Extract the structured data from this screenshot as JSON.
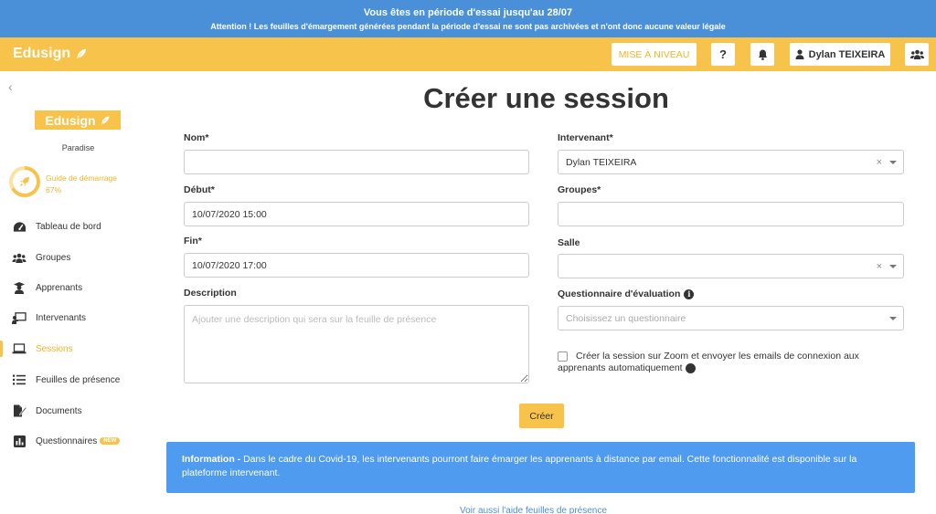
{
  "trial": {
    "line1": "Vous êtes en période d'essai jusqu'au 28/07",
    "line2": "Attention ! Les feuilles d'émargement générées pendant la période d'essai ne sont pas archivées et n'ont donc aucune valeur légale"
  },
  "navbar": {
    "brand": "Edusign",
    "upgrade_label": "MISE À NIVEAU",
    "help_label": "?",
    "user_name": "Dylan TEIXEIRA"
  },
  "sidebar": {
    "logo": "Edusign",
    "org_name": "Paradise",
    "guide": {
      "label": "Guide de démarrage",
      "progress": "67%",
      "progress_value": 0.67
    },
    "items": [
      {
        "label": "Tableau de bord",
        "icon": "dashboard-icon",
        "active": false
      },
      {
        "label": "Groupes",
        "icon": "users-icon",
        "active": false
      },
      {
        "label": "Apprenants",
        "icon": "graduate-icon",
        "active": false
      },
      {
        "label": "Intervenants",
        "icon": "teacher-icon",
        "active": false
      },
      {
        "label": "Sessions",
        "icon": "laptop-icon",
        "active": true
      },
      {
        "label": "Feuilles de présence",
        "icon": "list-icon",
        "active": false
      },
      {
        "label": "Documents",
        "icon": "file-signature-icon",
        "active": false
      },
      {
        "label": "Questionnaires",
        "icon": "chart-icon",
        "active": false,
        "badge": "NEW"
      }
    ]
  },
  "form": {
    "title": "Créer une session",
    "nom": {
      "label": "Nom*",
      "value": ""
    },
    "debut": {
      "label": "Début*",
      "value": "10/07/2020 15:00"
    },
    "fin": {
      "label": "Fin*",
      "value": "10/07/2020 17:00"
    },
    "description": {
      "label": "Description",
      "placeholder": "Ajouter une description qui sera sur la feuille de présence"
    },
    "intervenant": {
      "label": "Intervenant*",
      "value": "Dylan TEIXEIRA"
    },
    "groupes": {
      "label": "Groupes*",
      "value": ""
    },
    "salle": {
      "label": "Salle",
      "value": ""
    },
    "questionnaire": {
      "label": "Questionnaire d'évaluation",
      "placeholder": "Choisissez un questionnaire"
    },
    "zoom": {
      "label": "Créer la session sur Zoom et envoyer les emails de connexion aux apprenants automatiquement",
      "checked": false
    },
    "submit_label": "Créer"
  },
  "info": {
    "title": "Information - ",
    "text": "Dans le cadre du Covid-19, les intervenants pourront faire émarger les apprenants à distance par email. Cette fonctionnalité est disponible sur la plateforme intervenant."
  },
  "colors": {
    "primary": "#f7c34a",
    "trial_bar": "#4a90d9",
    "info": "#4e9bef"
  }
}
